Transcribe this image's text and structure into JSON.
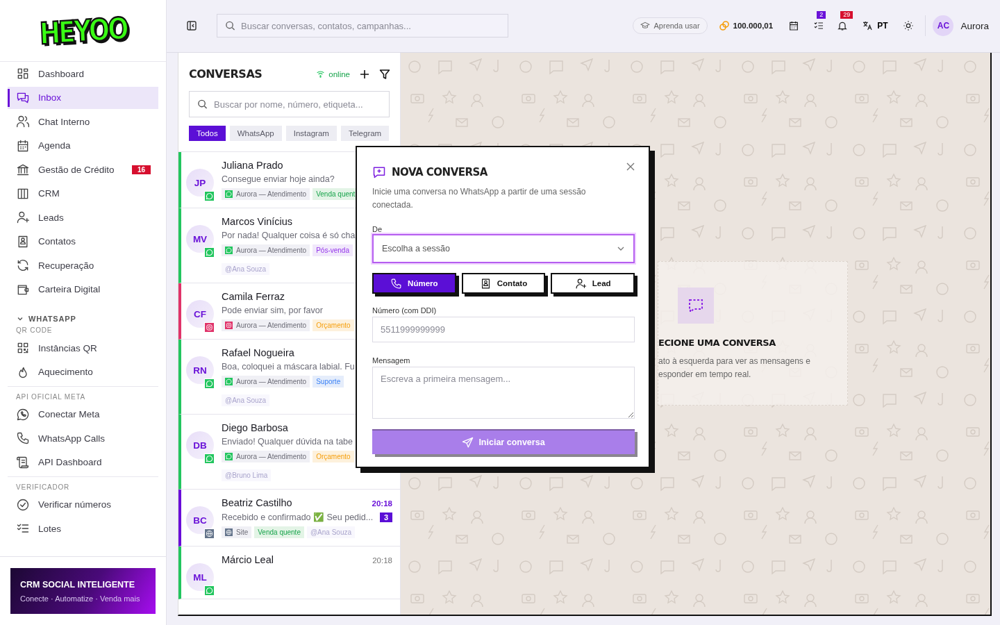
{
  "logo": "HEYOO",
  "sidebar": {
    "groups": [
      {
        "items": [
          {
            "label": "Dashboard",
            "selected": false
          },
          {
            "label": "Inbox",
            "selected": true
          },
          {
            "label": "Chat Interno",
            "selected": false
          },
          {
            "label": "Agenda",
            "selected": false
          },
          {
            "label": "Gestão de Crédito",
            "selected": false,
            "badge": "16"
          },
          {
            "label": "CRM",
            "selected": false
          },
          {
            "label": "Leads",
            "selected": false
          },
          {
            "label": "Contatos",
            "selected": false
          },
          {
            "label": "Recuperação",
            "selected": false
          },
          {
            "label": "Carteira Digital",
            "selected": false
          }
        ]
      },
      {
        "toggle": "WHATSAPP",
        "expanded": true,
        "title": "QR CODE",
        "items": [
          {
            "label": "Instâncias QR",
            "selected": false
          },
          {
            "label": "Aquecimento",
            "selected": false
          }
        ]
      },
      {
        "title": "API OFICIAL META",
        "items": [
          {
            "label": "Conectar Meta",
            "selected": false
          },
          {
            "label": "WhatsApp Calls",
            "selected": false
          },
          {
            "label": "API Dashboard",
            "selected": false
          }
        ]
      },
      {
        "title": "VERIFICADOR",
        "items": [
          {
            "label": "Verificar números",
            "selected": false
          },
          {
            "label": "Lotes",
            "selected": false
          }
        ]
      }
    ],
    "promo": {
      "title": "CRM SOCIAL INTELIGENTE",
      "subtitle": "Conecte · Automatize · Venda mais"
    }
  },
  "topbar": {
    "search_placeholder": "Buscar conversas, contatos, campanhas...",
    "learn": "Aprenda usar",
    "credits": "100.000,01",
    "tasks_badge": "2",
    "notifications_badge": "29",
    "language": "PT",
    "user_initials": "AC",
    "user_name": "Aurora"
  },
  "conversations": {
    "title": "CONVERSAS",
    "status": "online",
    "search_placeholder": "Buscar por nome, número, etiqueta...",
    "filters": [
      {
        "label": "Todos",
        "selected": true
      },
      {
        "label": "WhatsApp",
        "selected": false
      },
      {
        "label": "Instagram",
        "selected": false
      },
      {
        "label": "Telegram",
        "selected": false
      }
    ],
    "items": [
      {
        "initials": "JP",
        "name": "Juliana Prado",
        "preview": "Consegue enviar hoje ainda?",
        "kind": "whatsapp",
        "color": "#22c55e",
        "tags": [
          {
            "label": "Aurora — Atendimento",
            "kind": "session"
          },
          {
            "label": "Venda quent",
            "kind": "hot"
          }
        ]
      },
      {
        "initials": "MV",
        "name": "Marcos Vinícius",
        "preview": "Por nada! Qualquer coisa é só cha",
        "kind": "whatsapp",
        "color": "#22c55e",
        "tags": [
          {
            "label": "Aurora — Atendimento",
            "kind": "session"
          },
          {
            "label": "Pós-venda",
            "kind": "post"
          }
        ],
        "mention": "@Ana Souza"
      },
      {
        "initials": "CF",
        "name": "Camila Ferraz",
        "preview": "Pode enviar sim, por favor",
        "kind": "instagram",
        "color": "#e0336a",
        "tags": [
          {
            "label": "Aurora — Atendimento",
            "kind": "session"
          },
          {
            "label": "Orçamento",
            "kind": "quote"
          }
        ]
      },
      {
        "initials": "RN",
        "name": "Rafael Nogueira",
        "preview": "Boa, coloquei a máscara labial. Fu",
        "kind": "whatsapp",
        "color": "#22c55e",
        "tags": [
          {
            "label": "Aurora — Atendimento",
            "kind": "session"
          },
          {
            "label": "Suporte",
            "kind": "support"
          }
        ],
        "mention": "@Ana Souza"
      },
      {
        "initials": "DB",
        "name": "Diego Barbosa",
        "preview": "Enviado! Qualquer dúvida na tabe",
        "kind": "whatsapp",
        "color": "#22c55e",
        "tags": [
          {
            "label": "Aurora — Atendimento",
            "kind": "session"
          },
          {
            "label": "Orçamento",
            "kind": "quote"
          }
        ],
        "mention": "@Bruno Lima"
      },
      {
        "initials": "BC",
        "name": "Beatriz Castilho",
        "preview": "Recebido e confirmado ✅ Seu pedid...",
        "kind": "site",
        "color": "#6a0dd9",
        "time": "20:18",
        "unread": "3",
        "tags": [
          {
            "label": "Site",
            "kind": "session"
          },
          {
            "label": "Venda quente",
            "kind": "hot"
          }
        ],
        "mention": "@Ana Souza"
      },
      {
        "initials": "ML",
        "name": "Márcio Leal",
        "kind": "whatsapp",
        "color": "#22c55e",
        "time": "20:18"
      }
    ]
  },
  "empty_state": {
    "title": "ECIONE UMA CONVERSA",
    "lines": [
      "ato à esquerda para ver as mensagens e",
      "esponder em tempo real."
    ]
  },
  "modal": {
    "title": "NOVA CONVERSA",
    "description": "Inicie uma conversa no WhatsApp a partir de uma sessão conectada.",
    "from_label": "De",
    "select_placeholder": "Escolha a sessão",
    "modes": [
      {
        "label": "Número",
        "selected": true
      },
      {
        "label": "Contato",
        "selected": false
      },
      {
        "label": "Lead",
        "selected": false
      }
    ],
    "number_label": "Número (com DDI)",
    "number_placeholder": "5511999999999",
    "message_label": "Mensagem",
    "message_placeholder": "Escreva a primeira mensagem...",
    "submit": "Iniciar conversa"
  }
}
